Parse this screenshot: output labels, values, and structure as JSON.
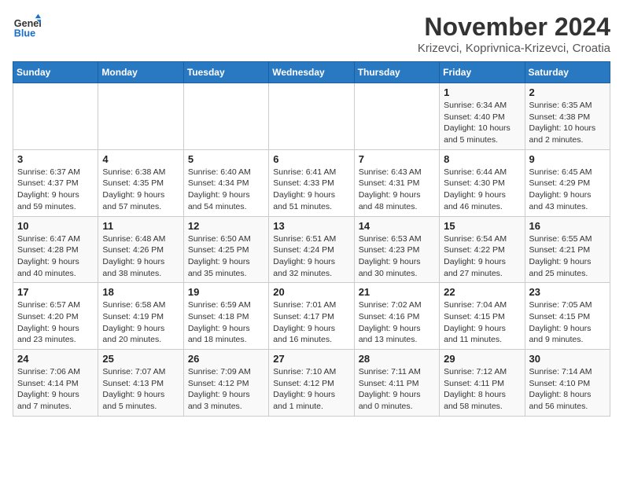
{
  "header": {
    "logo_line1": "General",
    "logo_line2": "Blue",
    "month_title": "November 2024",
    "location": "Krizevci, Koprivnica-Krizevci, Croatia"
  },
  "weekdays": [
    "Sunday",
    "Monday",
    "Tuesday",
    "Wednesday",
    "Thursday",
    "Friday",
    "Saturday"
  ],
  "weeks": [
    [
      {
        "day": "",
        "info": ""
      },
      {
        "day": "",
        "info": ""
      },
      {
        "day": "",
        "info": ""
      },
      {
        "day": "",
        "info": ""
      },
      {
        "day": "",
        "info": ""
      },
      {
        "day": "1",
        "info": "Sunrise: 6:34 AM\nSunset: 4:40 PM\nDaylight: 10 hours and 5 minutes."
      },
      {
        "day": "2",
        "info": "Sunrise: 6:35 AM\nSunset: 4:38 PM\nDaylight: 10 hours and 2 minutes."
      }
    ],
    [
      {
        "day": "3",
        "info": "Sunrise: 6:37 AM\nSunset: 4:37 PM\nDaylight: 9 hours and 59 minutes."
      },
      {
        "day": "4",
        "info": "Sunrise: 6:38 AM\nSunset: 4:35 PM\nDaylight: 9 hours and 57 minutes."
      },
      {
        "day": "5",
        "info": "Sunrise: 6:40 AM\nSunset: 4:34 PM\nDaylight: 9 hours and 54 minutes."
      },
      {
        "day": "6",
        "info": "Sunrise: 6:41 AM\nSunset: 4:33 PM\nDaylight: 9 hours and 51 minutes."
      },
      {
        "day": "7",
        "info": "Sunrise: 6:43 AM\nSunset: 4:31 PM\nDaylight: 9 hours and 48 minutes."
      },
      {
        "day": "8",
        "info": "Sunrise: 6:44 AM\nSunset: 4:30 PM\nDaylight: 9 hours and 46 minutes."
      },
      {
        "day": "9",
        "info": "Sunrise: 6:45 AM\nSunset: 4:29 PM\nDaylight: 9 hours and 43 minutes."
      }
    ],
    [
      {
        "day": "10",
        "info": "Sunrise: 6:47 AM\nSunset: 4:28 PM\nDaylight: 9 hours and 40 minutes."
      },
      {
        "day": "11",
        "info": "Sunrise: 6:48 AM\nSunset: 4:26 PM\nDaylight: 9 hours and 38 minutes."
      },
      {
        "day": "12",
        "info": "Sunrise: 6:50 AM\nSunset: 4:25 PM\nDaylight: 9 hours and 35 minutes."
      },
      {
        "day": "13",
        "info": "Sunrise: 6:51 AM\nSunset: 4:24 PM\nDaylight: 9 hours and 32 minutes."
      },
      {
        "day": "14",
        "info": "Sunrise: 6:53 AM\nSunset: 4:23 PM\nDaylight: 9 hours and 30 minutes."
      },
      {
        "day": "15",
        "info": "Sunrise: 6:54 AM\nSunset: 4:22 PM\nDaylight: 9 hours and 27 minutes."
      },
      {
        "day": "16",
        "info": "Sunrise: 6:55 AM\nSunset: 4:21 PM\nDaylight: 9 hours and 25 minutes."
      }
    ],
    [
      {
        "day": "17",
        "info": "Sunrise: 6:57 AM\nSunset: 4:20 PM\nDaylight: 9 hours and 23 minutes."
      },
      {
        "day": "18",
        "info": "Sunrise: 6:58 AM\nSunset: 4:19 PM\nDaylight: 9 hours and 20 minutes."
      },
      {
        "day": "19",
        "info": "Sunrise: 6:59 AM\nSunset: 4:18 PM\nDaylight: 9 hours and 18 minutes."
      },
      {
        "day": "20",
        "info": "Sunrise: 7:01 AM\nSunset: 4:17 PM\nDaylight: 9 hours and 16 minutes."
      },
      {
        "day": "21",
        "info": "Sunrise: 7:02 AM\nSunset: 4:16 PM\nDaylight: 9 hours and 13 minutes."
      },
      {
        "day": "22",
        "info": "Sunrise: 7:04 AM\nSunset: 4:15 PM\nDaylight: 9 hours and 11 minutes."
      },
      {
        "day": "23",
        "info": "Sunrise: 7:05 AM\nSunset: 4:15 PM\nDaylight: 9 hours and 9 minutes."
      }
    ],
    [
      {
        "day": "24",
        "info": "Sunrise: 7:06 AM\nSunset: 4:14 PM\nDaylight: 9 hours and 7 minutes."
      },
      {
        "day": "25",
        "info": "Sunrise: 7:07 AM\nSunset: 4:13 PM\nDaylight: 9 hours and 5 minutes."
      },
      {
        "day": "26",
        "info": "Sunrise: 7:09 AM\nSunset: 4:12 PM\nDaylight: 9 hours and 3 minutes."
      },
      {
        "day": "27",
        "info": "Sunrise: 7:10 AM\nSunset: 4:12 PM\nDaylight: 9 hours and 1 minute."
      },
      {
        "day": "28",
        "info": "Sunrise: 7:11 AM\nSunset: 4:11 PM\nDaylight: 9 hours and 0 minutes."
      },
      {
        "day": "29",
        "info": "Sunrise: 7:12 AM\nSunset: 4:11 PM\nDaylight: 8 hours and 58 minutes."
      },
      {
        "day": "30",
        "info": "Sunrise: 7:14 AM\nSunset: 4:10 PM\nDaylight: 8 hours and 56 minutes."
      }
    ]
  ]
}
